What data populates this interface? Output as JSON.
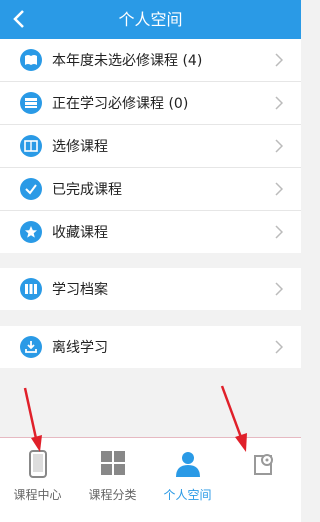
{
  "header": {
    "title": "个人空间"
  },
  "menu": {
    "group1": [
      {
        "label": "本年度未选必修课程 (4)",
        "icon": "book-icon"
      },
      {
        "label": "正在学习必修课程 (0)",
        "icon": "stack-icon"
      },
      {
        "label": "选修课程",
        "icon": "notebook-icon"
      },
      {
        "label": "已完成课程",
        "icon": "check-icon"
      },
      {
        "label": "收藏课程",
        "icon": "star-icon"
      }
    ],
    "group2": [
      {
        "label": "学习档案",
        "icon": "archive-icon"
      }
    ],
    "group3": [
      {
        "label": "离线学习",
        "icon": "download-icon"
      }
    ]
  },
  "tabbar": {
    "tabs": [
      {
        "label": "课程中心",
        "icon": "tablet-icon"
      },
      {
        "label": "课程分类",
        "icon": "grid-icon"
      },
      {
        "label": "个人空间",
        "icon": "person-icon",
        "active": true
      },
      {
        "label": "",
        "icon": "settings-icon"
      }
    ]
  },
  "colors": {
    "accent": "#2a9ae6",
    "annotation": "#e0202a",
    "background": "#f2f2f2"
  }
}
